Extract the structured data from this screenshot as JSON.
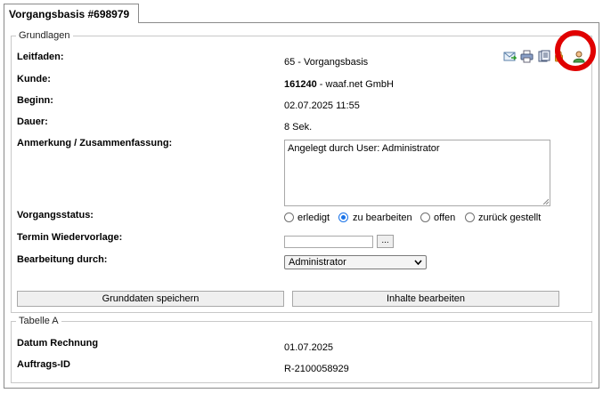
{
  "tab": {
    "title": "Vorgangsbasis #698979"
  },
  "grundlagen": {
    "legend": "Grundlagen",
    "leitfaden_label": "Leitfaden:",
    "leitfaden_value": "65 - Vorgangsbasis",
    "kunde_label": "Kunde:",
    "kunde_id": "161240",
    "kunde_rest": " - waaf.net GmbH",
    "beginn_label": "Beginn:",
    "beginn_value": "02.07.2025 11:55",
    "dauer_label": "Dauer:",
    "dauer_value": "8 Sek.",
    "anmerkung_label": "Anmerkung / Zusammenfassung:",
    "anmerkung_value": "Angelegt durch User: Administrator",
    "status_label": "Vorgangsstatus:",
    "status_options": [
      "erledigt",
      "zu bearbeiten",
      "offen",
      "zurück gestellt"
    ],
    "status_selected": "zu bearbeiten",
    "termin_label": "Termin Wiedervorlage:",
    "termin_value": "",
    "termin_button": "...",
    "bearbeitung_label": "Bearbeitung durch:",
    "bearbeitung_value": "Administrator",
    "save_button": "Grunddaten speichern",
    "edit_button": "Inhalte bearbeiten"
  },
  "toolbar_icons": [
    "mail-icon",
    "printer-icon",
    "document-icon",
    "lock-icon",
    "user-icon"
  ],
  "highlight_color": "#e00000",
  "tabelle": {
    "legend": "Tabelle A",
    "datum_label": "Datum Rechnung",
    "datum_value": "01.07.2025",
    "auftrag_label": "Auftrags-ID",
    "auftrag_value": "R-2100058929"
  }
}
